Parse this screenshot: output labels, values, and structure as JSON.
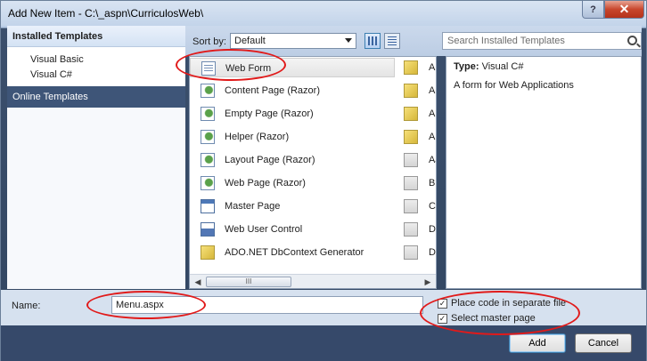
{
  "window": {
    "title": "Add New Item - C:\\_aspn\\CurriculosWeb\\"
  },
  "titlebar": {
    "help": "?",
    "close": "✕"
  },
  "left": {
    "installed_header": "Installed Templates",
    "languages": [
      "Visual Basic",
      "Visual C#"
    ],
    "online": "Online Templates"
  },
  "sort": {
    "label": "Sort by:",
    "value": "Default"
  },
  "search": {
    "placeholder": "Search Installed Templates"
  },
  "templates": [
    {
      "label": "Web Form",
      "icon": "web-form-icon"
    },
    {
      "label": "Content Page (Razor)",
      "icon": "razor-page-icon"
    },
    {
      "label": "Empty Page (Razor)",
      "icon": "razor-page-icon"
    },
    {
      "label": "Helper (Razor)",
      "icon": "razor-page-icon"
    },
    {
      "label": "Layout Page (Razor)",
      "icon": "razor-page-icon"
    },
    {
      "label": "Web Page (Razor)",
      "icon": "razor-page-icon"
    },
    {
      "label": "Master Page",
      "icon": "master-page-icon"
    },
    {
      "label": "Web User Control",
      "icon": "user-control-icon"
    },
    {
      "label": "ADO.NET DbContext Generator",
      "icon": "ado-icon"
    }
  ],
  "templates_col2": [
    {
      "label": "ADC",
      "icon": "ado-icon"
    },
    {
      "label": "ADC",
      "icon": "ado-icon"
    },
    {
      "label": "ADC",
      "icon": "ado-icon"
    },
    {
      "label": "ADC",
      "icon": "ado-icon"
    },
    {
      "label": "AJA",
      "icon": "ajax-icon"
    },
    {
      "label": "Brov",
      "icon": "browser-icon"
    },
    {
      "label": "Clas",
      "icon": "class-icon"
    },
    {
      "label": "Dat",
      "icon": "dataset-icon"
    },
    {
      "label": "Dyn",
      "icon": "dynamic-icon"
    }
  ],
  "details": {
    "type_label": "Type:",
    "type_value": "Visual C#",
    "description": "A form for Web Applications"
  },
  "name_field": {
    "label": "Name:",
    "value": "Menu.aspx"
  },
  "options": {
    "separate_file": "Place code in separate file",
    "master_page": "Select master page"
  },
  "buttons": {
    "add": "Add",
    "cancel": "Cancel"
  },
  "scroll": {
    "thumb": "III",
    "left": "◀",
    "right": "▶"
  }
}
